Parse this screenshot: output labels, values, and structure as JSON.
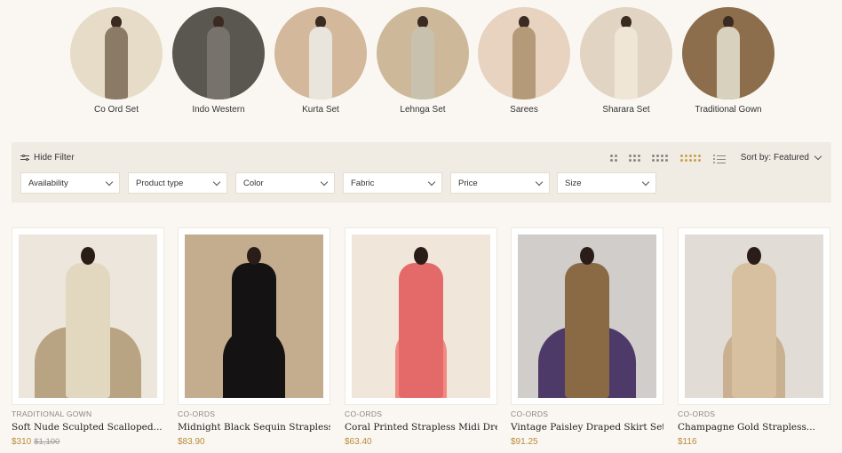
{
  "categories": [
    {
      "label": "Co Ord Set",
      "bg": "#e6dcc8",
      "dress": "#8a7a66"
    },
    {
      "label": "Indo Western",
      "bg": "#5a5650",
      "dress": "#77736c"
    },
    {
      "label": "Kurta Set",
      "bg": "#d4b89c",
      "dress": "#e9e4dc"
    },
    {
      "label": "Lehnga Set",
      "bg": "#cdb99a",
      "dress": "#c8c1ae"
    },
    {
      "label": "Sarees",
      "bg": "#e7d3c0",
      "dress": "#b49a78"
    },
    {
      "label": "Sharara Set",
      "bg": "#e2d4c2",
      "dress": "#efe6d6"
    },
    {
      "label": "Traditional Gown",
      "bg": "#8c6d4c",
      "dress": "#d8d1be"
    }
  ],
  "filterbar": {
    "hide_filter": "Hide Filter",
    "sort_label": "Sort by: Featured",
    "filters": [
      "Availability",
      "Product type",
      "Color",
      "Fabric",
      "Price",
      "Size"
    ]
  },
  "products": [
    {
      "category": "TRADITIONAL GOWN",
      "title": "Soft Nude Sculpted Scalloped...",
      "price": "$310",
      "old_price": "$1,100",
      "bg": "#ece6dc",
      "dress": "#e2d8c0",
      "accent": "#b8a482"
    },
    {
      "category": "CO-ORDS",
      "title": "Midnight Black Sequin Strapless...",
      "price": "$83.90",
      "old_price": "",
      "bg": "#c4ac8e",
      "dress": "#141212",
      "accent": "#141212"
    },
    {
      "category": "CO-ORDS",
      "title": "Coral Printed Strapless Midi Dre...",
      "price": "$63.40",
      "old_price": "",
      "bg": "#f1e6da",
      "dress": "#e46a6a",
      "accent": "#f08a82"
    },
    {
      "category": "CO-ORDS",
      "title": "Vintage Paisley Draped Skirt Set...",
      "price": "$91.25",
      "old_price": "",
      "bg": "#d0cdca",
      "dress": "#8a6a44",
      "accent": "#4d3a68"
    },
    {
      "category": "CO-ORDS",
      "title": "Champagne Gold Strapless...",
      "price": "$116",
      "old_price": "",
      "bg": "#e2dcd6",
      "dress": "#d6c0a0",
      "accent": "#c8b090"
    }
  ]
}
